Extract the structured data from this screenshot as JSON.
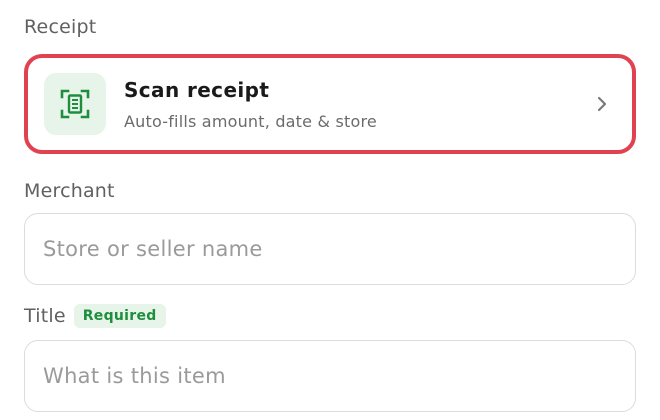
{
  "receipt_section": {
    "label": "Receipt",
    "scan_card": {
      "icon": "scan-receipt-icon",
      "title": "Scan receipt",
      "subtitle": "Auto-fills amount, date & store",
      "chevron_icon": "chevron-right-icon",
      "highlight_color": "#e0434f"
    }
  },
  "merchant_section": {
    "label": "Merchant",
    "input": {
      "value": "",
      "placeholder": "Store or seller name"
    }
  },
  "title_section": {
    "label": "Title",
    "badge": "Required",
    "input": {
      "value": "",
      "placeholder": "What is this item"
    }
  },
  "colors": {
    "accent_green": "#1e8e3e",
    "accent_green_bg": "#e6f4ea",
    "highlight_red": "#e0434f"
  }
}
